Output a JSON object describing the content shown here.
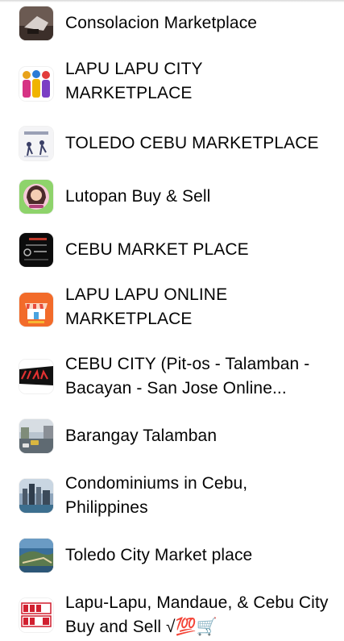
{
  "groups": [
    {
      "name": "Consolacion Marketplace",
      "icon": "group-photo-icon"
    },
    {
      "name": "LAPU LAPU CITY MARKETPLACE",
      "icon": "group-photo-icon"
    },
    {
      "name": "TOLEDO CEBU MARKETPLACE",
      "icon": "group-photo-icon"
    },
    {
      "name": "Lutopan Buy & Sell",
      "icon": "group-photo-icon"
    },
    {
      "name": "CEBU MARKET PLACE",
      "icon": "group-photo-icon"
    },
    {
      "name": "LAPU LAPU ONLINE MARKETPLACE",
      "icon": "group-photo-icon"
    },
    {
      "name": "CEBU CITY (Pit-os - Talamban - Bacayan - San Jose Online...",
      "icon": "group-photo-icon"
    },
    {
      "name": "Barangay Talamban",
      "icon": "group-photo-icon"
    },
    {
      "name": "Condominiums in Cebu, Philippines",
      "icon": "group-photo-icon"
    },
    {
      "name": "Toledo City Market place",
      "icon": "group-photo-icon"
    },
    {
      "name": "Lapu-Lapu, Mandaue, & Cebu City Buy and Sell √💯🛒",
      "icon": "group-photo-icon"
    }
  ]
}
